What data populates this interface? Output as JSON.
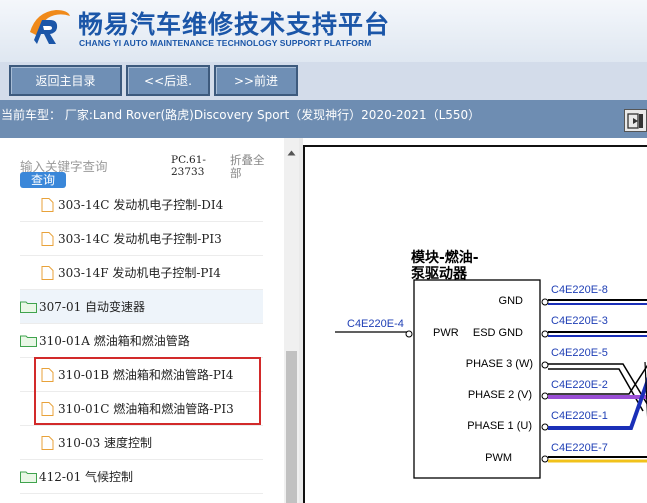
{
  "header": {
    "title_cn": "畅易汽车维修技术支持平台",
    "title_en": "CHANG YI AUTO MAINTENANCE TECHNOLOGY SUPPORT PLATFORM",
    "logo_icon": "cy-logo-icon"
  },
  "nav": {
    "home_label": "返回主目录",
    "back_label": "<<后退.",
    "forward_label": ">>前进"
  },
  "car": {
    "text": "当前车型： 厂家:Land Rover(路虎)Discovery Sport（发现神行）2020-2021（L550）",
    "exit_icon": "exit-icon"
  },
  "search": {
    "placeholder": "输入关键字查询",
    "button_label": "查询",
    "code": "PC.61-23733",
    "collapse_label": "折叠全部"
  },
  "tree": {
    "items": [
      {
        "label": "303-14C 发动机电子控制-DI4",
        "type": "file"
      },
      {
        "label": "303-14C 发动机电子控制-PI3",
        "type": "file"
      },
      {
        "label": "303-14F 发动机电子控制-PI4",
        "type": "file"
      },
      {
        "label": "307-01 自动变速器",
        "type": "folder"
      },
      {
        "label": "310-01A 燃油箱和燃油管路",
        "type": "folder"
      },
      {
        "label": "310-01B 燃油箱和燃油管路-PI4",
        "type": "file"
      },
      {
        "label": "310-01C 燃油箱和燃油管路-PI3",
        "type": "file"
      },
      {
        "label": "310-03 速度控制",
        "type": "file"
      },
      {
        "label": "412-01 气候控制",
        "type": "folder"
      }
    ]
  },
  "diagram": {
    "module_title_1": "模块-燃油-",
    "module_title_2": "泵驱动器",
    "left_connector": "C4E220E-4",
    "pin_pwr": "PWR",
    "pins": [
      "GND",
      "ESD GND",
      "PHASE 3 (W)",
      "PHASE 2 (V)",
      "PHASE 1 (U)",
      "PWM"
    ],
    "right_connectors": [
      "C4E220E-8",
      "C4E220E-3",
      "C4E220E-5",
      "C4E220E-2",
      "C4E220E-1",
      "C4E220E-7"
    ],
    "colors": {
      "blue": "#1a2fb8",
      "purple": "#9a4fd6",
      "yellow": "#f1c21b",
      "black": "#000000",
      "label_blue": "#1f3fb5"
    }
  }
}
